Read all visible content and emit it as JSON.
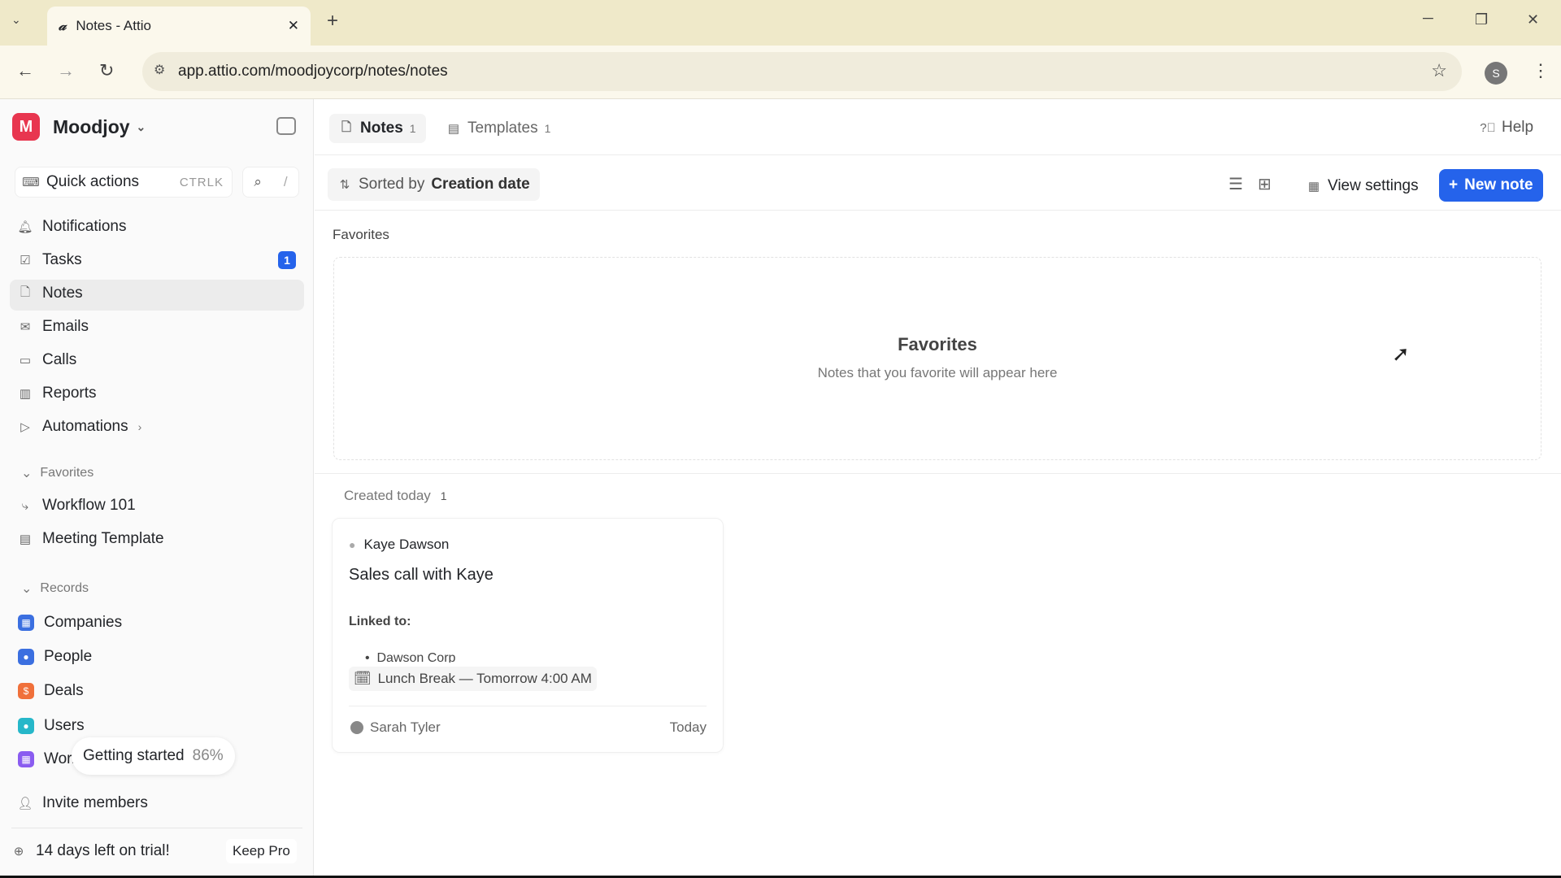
{
  "browser": {
    "tab_title": "Notes - Attio",
    "url": "app.attio.com/moodjoycorp/notes/notes",
    "profile_initial": "S"
  },
  "sidebar": {
    "workspace": "Moodjoy",
    "workspace_initial": "M",
    "quick_actions": "Quick actions",
    "quick_shortcut": "CTRLK",
    "search_shortcut": "/",
    "items": [
      {
        "label": "Notifications"
      },
      {
        "label": "Tasks",
        "badge": "1"
      },
      {
        "label": "Notes"
      },
      {
        "label": "Emails"
      },
      {
        "label": "Calls"
      },
      {
        "label": "Reports"
      },
      {
        "label": "Automations"
      }
    ],
    "favorites_header": "Favorites",
    "favorites": [
      {
        "label": "Workflow 101"
      },
      {
        "label": "Meeting Template"
      }
    ],
    "records_header": "Records",
    "records": [
      {
        "label": "Companies",
        "color": "#3b6fe0"
      },
      {
        "label": "People",
        "color": "#3b6fe0"
      },
      {
        "label": "Deals",
        "color": "#f0703a"
      },
      {
        "label": "Users",
        "color": "#26b7c9"
      },
      {
        "label": "Wor.",
        "color": "#8a5cf0"
      }
    ],
    "getting_started": "Getting started",
    "getting_started_pct": "86%",
    "invite": "Invite members",
    "trial": "14 days left on trial!",
    "keep_pro": "Keep Pro"
  },
  "main": {
    "tabs": [
      {
        "label": "Notes",
        "count": "1"
      },
      {
        "label": "Templates",
        "count": "1"
      }
    ],
    "help": "Help",
    "sort_prefix": "Sorted by",
    "sort_field": "Creation date",
    "view_settings": "View settings",
    "new_note": "New note",
    "favorites_label": "Favorites",
    "favorites_empty_title": "Favorites",
    "favorites_empty_text": "Notes that you favorite will appear here",
    "group_label": "Created today",
    "group_count": "1",
    "card": {
      "person": "Kaye Dawson",
      "title": "Sales call with Kaye",
      "linked_label": "Linked to:",
      "linked_item": "Dawson Corp",
      "event": "Lunch Break — Tomorrow 4:00 AM",
      "author": "Sarah Tyler",
      "date": "Today"
    }
  },
  "colors": {
    "accent": "#2563eb"
  }
}
